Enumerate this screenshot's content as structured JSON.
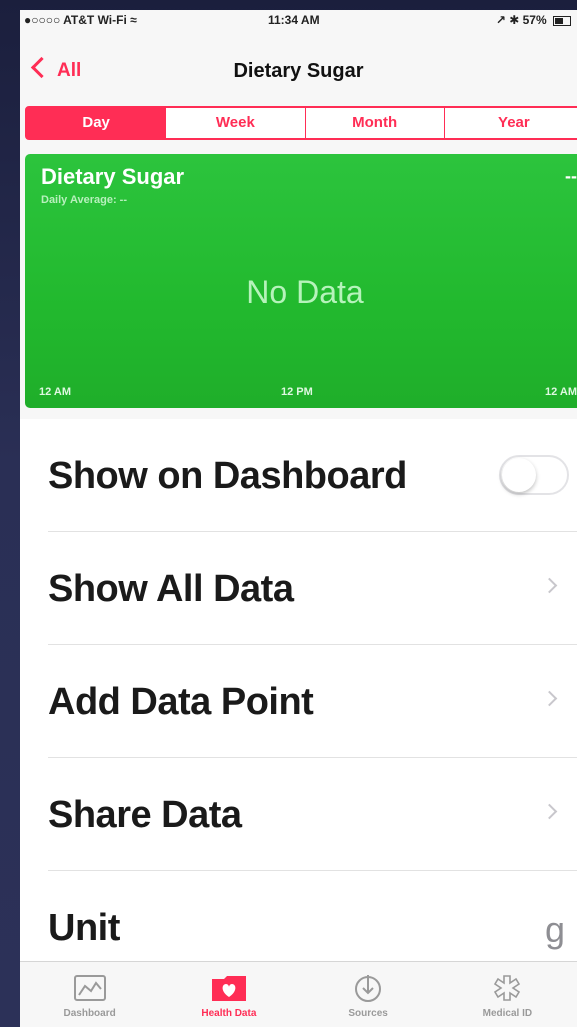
{
  "status_bar": {
    "carrier": "●○○○○ AT&T Wi-Fi ≈",
    "time": "11:34 AM",
    "right": "↗ ✱ 57%"
  },
  "nav": {
    "back_label": "All",
    "title": "Dietary Sugar"
  },
  "segments": [
    {
      "label": "Day",
      "active": true
    },
    {
      "label": "Week",
      "active": false
    },
    {
      "label": "Month",
      "active": false
    },
    {
      "label": "Year",
      "active": false
    }
  ],
  "chart_data": {
    "type": "bar",
    "title": "Dietary Sugar",
    "subtitle": "Daily Average: --",
    "current_value": "--",
    "empty_message": "No Data",
    "x_ticks": [
      "12 AM",
      "12 PM",
      "12 AM"
    ],
    "series": [],
    "background_color": "#22b92e"
  },
  "list": {
    "show_on_dashboard": "Show on Dashboard",
    "show_on_dashboard_enabled": false,
    "show_all_data": "Show All Data",
    "add_data_point": "Add Data Point",
    "share_data": "Share Data",
    "unit_label": "Unit",
    "unit_value": "g"
  },
  "tabbar": {
    "tabs": [
      {
        "label": "Dashboard",
        "icon": "dashboard-icon"
      },
      {
        "label": "Health Data",
        "icon": "health-data-icon",
        "active": true
      },
      {
        "label": "Sources",
        "icon": "sources-icon"
      },
      {
        "label": "Medical ID",
        "icon": "medical-id-icon"
      }
    ]
  },
  "colors": {
    "accent": "#ff2d55",
    "chart_green": "#22b92e"
  }
}
